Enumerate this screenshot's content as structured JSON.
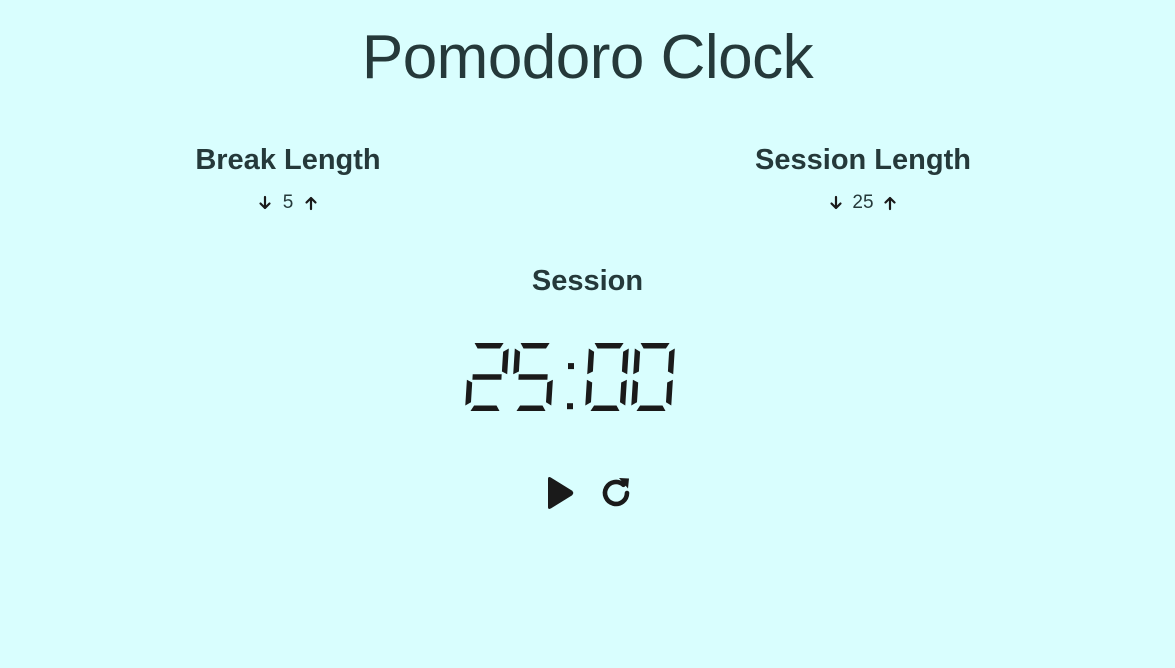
{
  "app": {
    "title": "Pomodoro Clock"
  },
  "break": {
    "label": "Break Length",
    "value": "5",
    "decrement_icon": "arrow-down-icon",
    "increment_icon": "arrow-up-icon"
  },
  "session": {
    "label": "Session Length",
    "value": "25",
    "decrement_icon": "arrow-down-icon",
    "increment_icon": "arrow-up-icon"
  },
  "timer": {
    "label": "Session",
    "time": "25:00"
  },
  "controls": {
    "play_icon": "play-icon",
    "reset_icon": "refresh-icon"
  },
  "colors": {
    "background": "#d9fefe",
    "text": "#25393a",
    "icon": "#1a1a1a"
  }
}
